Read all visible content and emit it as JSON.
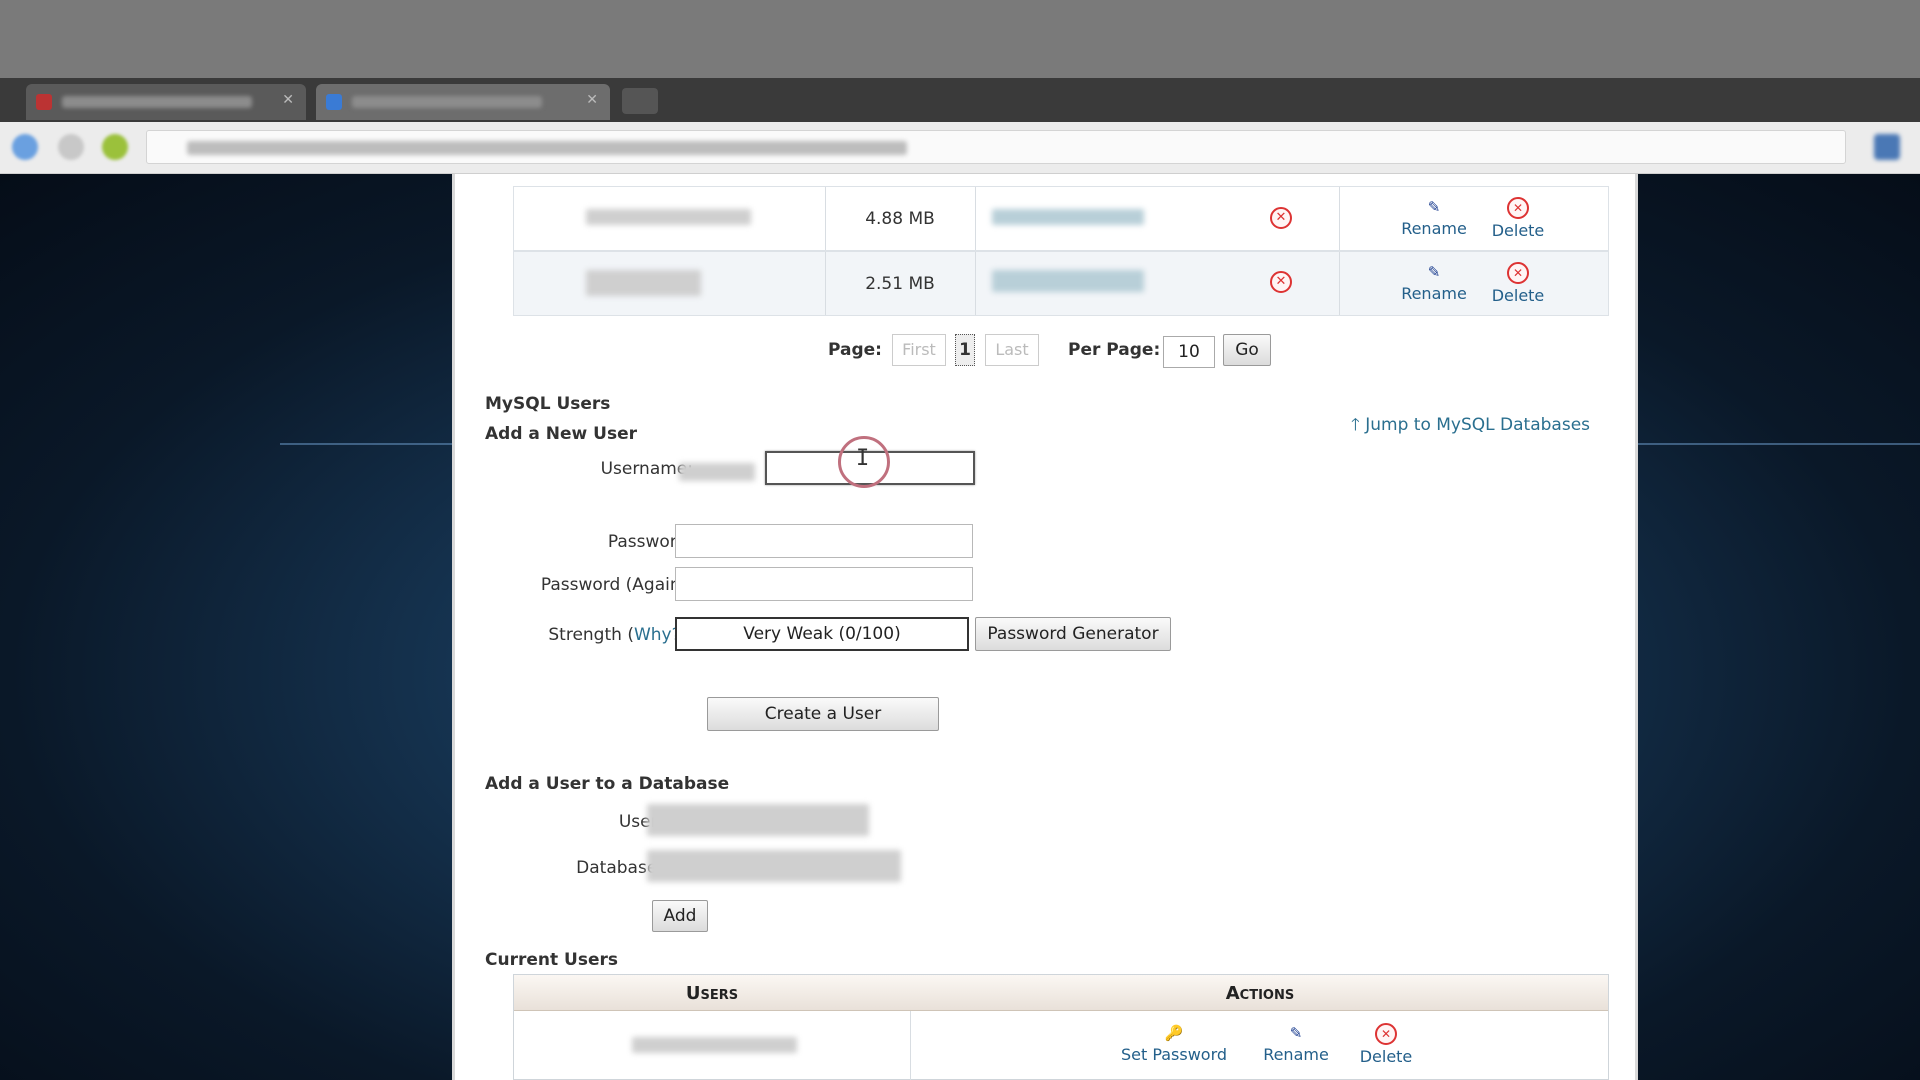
{
  "db_table": {
    "rows": [
      {
        "size": "4.88 MB",
        "actions": {
          "rename": "Rename",
          "delete": "Delete"
        }
      },
      {
        "size": "2.51 MB",
        "actions": {
          "rename": "Rename",
          "delete": "Delete"
        }
      }
    ]
  },
  "pagination": {
    "page_label": "Page:",
    "first": "First",
    "current": "1",
    "last": "Last",
    "per_page_label": "Per Page:",
    "per_page_value": "10",
    "go": "Go"
  },
  "mysql_users": {
    "section_title": "MySQL Users",
    "add_new_user_title": "Add a New User",
    "jump_link": "Jump to MySQL Databases",
    "username_label": "Username:",
    "username_value": "",
    "password_label": "Password:",
    "password_again_label": "Password (Again):",
    "strength_label_prefix": "Strength (",
    "strength_why": "Why?",
    "strength_label_suffix": "):",
    "strength_value": "Very Weak (0/100)",
    "password_generator": "Password Generator",
    "create_user": "Create a User"
  },
  "add_user_to_db": {
    "title": "Add a User to a Database",
    "user_label": "User:",
    "database_label": "Database:",
    "add_button": "Add"
  },
  "current_users": {
    "title": "Current Users",
    "col_users": "Users",
    "col_actions": "Actions",
    "row_actions": {
      "set_password": "Set Password",
      "rename": "Rename",
      "delete": "Delete"
    }
  },
  "icons": {
    "rename": "rename-icon",
    "delete": "delete-icon",
    "key": "key-icon",
    "arrow_up": "arrow-up-icon"
  },
  "colors": {
    "link": "#2a6f8f",
    "delete_red": "#dd3333",
    "header_bg": "#e9e1d9"
  }
}
